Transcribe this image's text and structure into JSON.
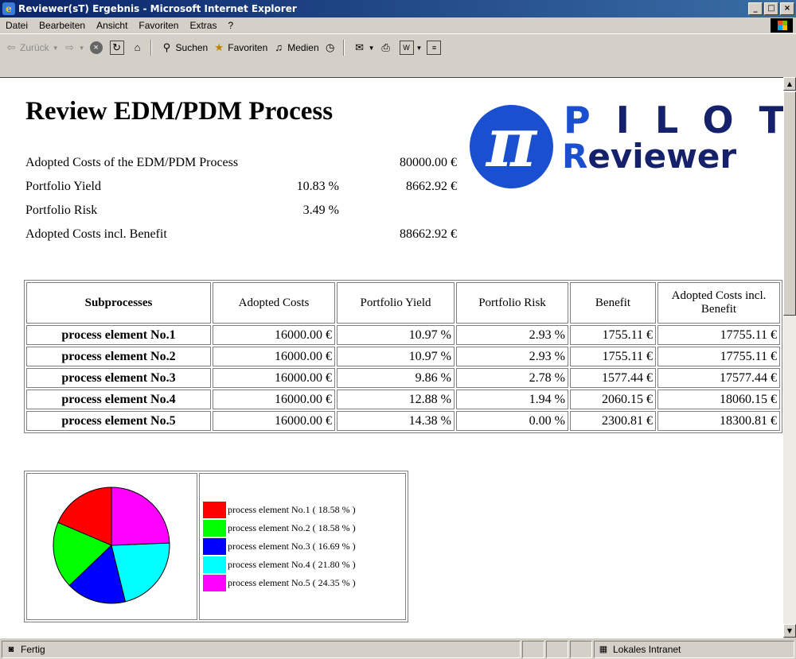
{
  "window": {
    "title": "Reviewer(sT) Ergebnis - Microsoft Internet Explorer"
  },
  "menu": [
    "Datei",
    "Bearbeiten",
    "Ansicht",
    "Favoriten",
    "Extras",
    "?"
  ],
  "toolbar": {
    "back_label": "Zurück",
    "search_label": "Suchen",
    "favorites_label": "Favoriten",
    "media_label": "Medien"
  },
  "page": {
    "title": "Review EDM/PDM Process",
    "logo": {
      "line1": "PILOT",
      "line2": "Reviewer"
    },
    "summary": [
      {
        "label": "Adopted Costs of the EDM/PDM Process",
        "percent": "",
        "amount": "80000.00 €"
      },
      {
        "label": "Portfolio Yield",
        "percent": "10.83 %",
        "amount": "8662.92 €"
      },
      {
        "label": "Portfolio Risk",
        "percent": "3.49 %",
        "amount": ""
      },
      {
        "label": "Adopted Costs incl. Benefit",
        "percent": "",
        "amount": "88662.92 €"
      }
    ],
    "table": {
      "headers": [
        "Subprocesses",
        "Adopted Costs",
        "Portfolio Yield",
        "Portfolio Risk",
        "Benefit",
        "Adopted Costs incl. Benefit"
      ],
      "rows": [
        [
          "process element No.1",
          "16000.00 €",
          "10.97 %",
          "2.93 %",
          "1755.11 €",
          "17755.11 €"
        ],
        [
          "process element No.2",
          "16000.00 €",
          "10.97 %",
          "2.93 %",
          "1755.11 €",
          "17755.11 €"
        ],
        [
          "process element No.3",
          "16000.00 €",
          "9.86 %",
          "2.78 %",
          "1577.44 €",
          "17577.44 €"
        ],
        [
          "process element No.4",
          "16000.00 €",
          "12.88 %",
          "1.94 %",
          "2060.15 €",
          "18060.15 €"
        ],
        [
          "process element No.5",
          "16000.00 €",
          "14.38 %",
          "0.00 %",
          "2300.81 €",
          "18300.81 €"
        ]
      ]
    }
  },
  "chart_data": {
    "type": "pie",
    "slices": [
      {
        "label": "process element No.1",
        "value": 18.58,
        "text": "process element No.1 ( 18.58 % )",
        "color": "#ff0000"
      },
      {
        "label": "process element No.2",
        "value": 18.58,
        "text": "process element No.2 ( 18.58 % )",
        "color": "#00ff00"
      },
      {
        "label": "process element No.3",
        "value": 16.69,
        "text": "process element No.3 ( 16.69 % )",
        "color": "#0000ff"
      },
      {
        "label": "process element No.4",
        "value": 21.8,
        "text": "process element No.4 ( 21.80 % )",
        "color": "#00ffff"
      },
      {
        "label": "process element No.5",
        "value": 24.35,
        "text": "process element No.5 ( 24.35 % )",
        "color": "#ff00ff"
      }
    ],
    "legend_placement": "right"
  },
  "status": {
    "left": "Fertig",
    "zone": "Lokales Intranet"
  }
}
